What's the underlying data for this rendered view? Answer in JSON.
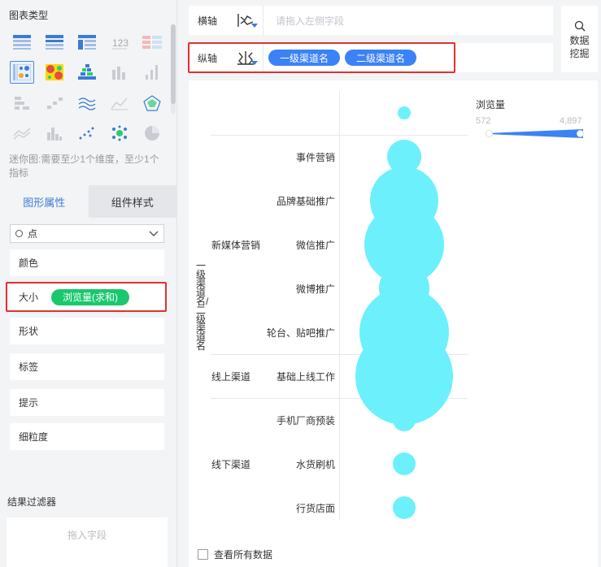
{
  "chart_types": {
    "title": "图表类型",
    "hint": "迷你图:需要至少1个维度，至少1个指标",
    "icons": [
      "table-icon",
      "group-table-icon",
      "cross-table-icon",
      "kpi-number-icon",
      "mini-chart-icon",
      "scatter-matrix-icon",
      "heatmap-icon",
      "dot-matrix-icon",
      "column-chart-icon",
      "bar-chart-icon",
      "grouped-dot-icon",
      "step-column-icon",
      "multi-line-icon",
      "area-line-icon",
      "radar-icon",
      "stacked-area-icon",
      "histogram-icon",
      "scatter-icon",
      "bubble-icon",
      "pie-icon"
    ]
  },
  "tabs": {
    "graphic_props": "图形属性",
    "component_style": "组件样式"
  },
  "props": {
    "mark_type": "点",
    "color": "颜色",
    "size": "大小",
    "size_field": "浏览量(求和)",
    "shape": "形状",
    "label": "标签",
    "tooltip": "提示",
    "granularity": "细粒度"
  },
  "filter": {
    "title": "结果过滤器",
    "placeholder": "拖入字段"
  },
  "x_axis": {
    "label": "横轴",
    "placeholder": "请拖入左侧字段"
  },
  "y_axis": {
    "label": "纵轴",
    "fields": [
      "一级渠道名",
      "二级渠道名"
    ]
  },
  "mining": {
    "line1": "数据",
    "line2": "挖掘"
  },
  "view_all": "查看所有数据",
  "accent_color": "#3b82f6",
  "bubble_color": "#6cf0fc",
  "chart_data": {
    "type": "scatter",
    "ylabel": "一级渠道名/二级渠道名",
    "measure": "浏览量",
    "size_range": [
      572,
      4897
    ],
    "groups": [
      {
        "name": "",
        "rows": [
          ""
        ]
      },
      {
        "name": "新媒体营销",
        "rows": [
          "事件营销",
          "品牌基础推广",
          "微信推广",
          "微博推广",
          "轮台、贴吧推广"
        ]
      },
      {
        "name": "线上渠道",
        "rows": [
          "基础上线工作"
        ]
      },
      {
        "name": "线下渠道",
        "rows": [
          "手机厂商预装",
          "水货刷机",
          "行货店面"
        ]
      }
    ],
    "points": [
      {
        "channel": "",
        "sub": "",
        "value": 572
      },
      {
        "channel": "新媒体营销",
        "sub": "事件营销",
        "value": 1250
      },
      {
        "channel": "新媒体营销",
        "sub": "品牌基础推广",
        "value": 2950
      },
      {
        "channel": "新媒体营销",
        "sub": "微信推广",
        "value": 3600
      },
      {
        "channel": "新媒体营销",
        "sub": "微博推广",
        "value": 1950
      },
      {
        "channel": "新媒体营销",
        "sub": "轮台、贴吧推广",
        "value": 4300
      },
      {
        "channel": "线上渠道",
        "sub": "基础上线工作",
        "value": 4897
      },
      {
        "channel": "线下渠道",
        "sub": "手机厂商预装",
        "value": 880
      },
      {
        "channel": "线下渠道",
        "sub": "水货刷机",
        "value": 880
      },
      {
        "channel": "线下渠道",
        "sub": "行货店面",
        "value": 880
      }
    ]
  }
}
